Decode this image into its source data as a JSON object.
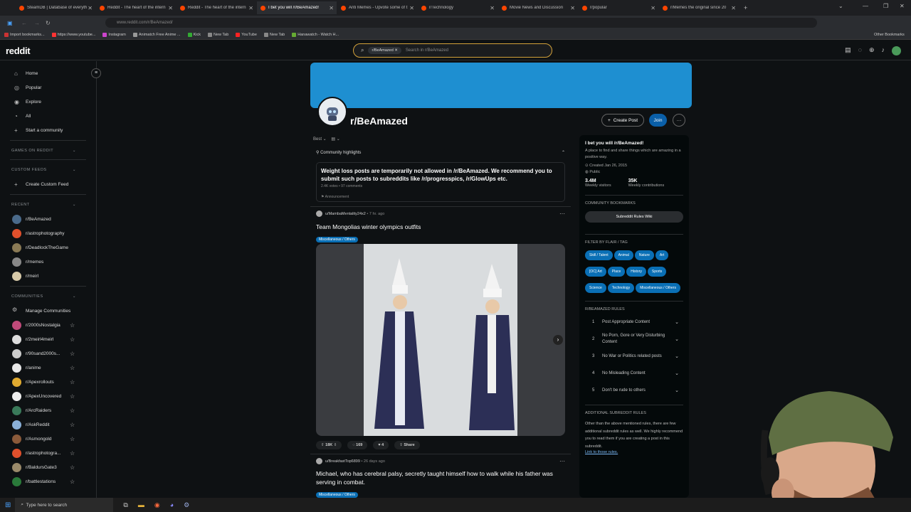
{
  "browser": {
    "tabs": [
      "SteamDB | Database of everyth",
      "Reddit - The heart of the intern",
      "Reddit - The heart of the intern",
      "I bet you will /r/BeAmazed!",
      "Anti Memes - Upvote some of t",
      "r/Technology",
      "Movie News and Discussion",
      "r/popular",
      "r/Memes the original since 20"
    ],
    "url": "www.reddit.com/r/BeAmazed/",
    "bookmarks": [
      "Import bookmarks...",
      "https://www.youtube...",
      "Instagram",
      "Animatch Free Anime ...",
      "Kick",
      "New Tab",
      "YouTube",
      "New Tab",
      "Hanawatch - Watch H..."
    ],
    "other_bookmarks": "Other Bookmarks"
  },
  "header": {
    "logo": "reddit",
    "search_chip": "r/BeAmazed",
    "search_placeholder": "Search in r/BeAmazed"
  },
  "sidebar": {
    "nav": [
      {
        "label": "Home",
        "icon": "home-icon",
        "glyph": "⌂"
      },
      {
        "label": "Popular",
        "icon": "popular-icon",
        "glyph": "◎"
      },
      {
        "label": "Explore",
        "icon": "explore-icon",
        "glyph": "◉"
      },
      {
        "label": "All",
        "icon": "all-icon",
        "glyph": "◔"
      },
      {
        "label": "Start a community",
        "icon": "plus-icon",
        "glyph": "+"
      }
    ],
    "games": "GAMES ON REDDIT",
    "custom_feeds": "CUSTOM FEEDS",
    "create_feed": "Create Custom Feed",
    "recent_title": "RECENT",
    "recent": [
      {
        "name": "r/BeAmazed",
        "color": "#4a6a8a"
      },
      {
        "name": "r/astrophotography",
        "color": "#e0502c"
      },
      {
        "name": "r/DeadlockTheGame",
        "color": "#8a7a55"
      },
      {
        "name": "r/memes",
        "color": "#888888"
      },
      {
        "name": "r/meirl",
        "color": "#d6c9a8"
      }
    ],
    "communities_title": "COMMUNITIES",
    "manage": "Manage Communities",
    "communities": [
      {
        "name": "r/2000sNostalgia",
        "color": "#c04a7a"
      },
      {
        "name": "r/2meirl4meirl",
        "color": "#dddddd"
      },
      {
        "name": "r/90sand2000s...",
        "color": "#cccccc"
      },
      {
        "name": "r/anime",
        "color": "#e8e8e8"
      },
      {
        "name": "r/Apexrollouts",
        "color": "#e0aa30"
      },
      {
        "name": "r/ApexUncovered",
        "color": "#eeeeee"
      },
      {
        "name": "r/ArcRaiders",
        "color": "#3a7a5a"
      },
      {
        "name": "r/AskReddit",
        "color": "#8ab0d8"
      },
      {
        "name": "r/Asmongold",
        "color": "#8a5a3a"
      },
      {
        "name": "r/astrophotogra...",
        "color": "#e0502c"
      },
      {
        "name": "r/BaldursGate3",
        "color": "#9a8a6a"
      },
      {
        "name": "r/battlestations",
        "color": "#2a7a3a"
      }
    ]
  },
  "community": {
    "name": "r/BeAmazed",
    "create_post": "Create Post",
    "join": "Join"
  },
  "feed": {
    "sort": "Best",
    "highlights_title": "Community highlights",
    "highlight_text": "Weight loss posts are temporarily not allowed in /r/BeAmazed. We recommend you to submit such posts to subreddits like /r/progresspics, /r/GlowUps etc.",
    "highlight_meta": "2.4K votes • 97 comments",
    "highlight_tag": "Announcement",
    "posts": [
      {
        "user": "u/MambaMentality24x2",
        "time": "• 7 hr. ago",
        "title": "Team Mongolias winter olympics outfits",
        "flair": "Miscellaneous / Others",
        "votes": "18K",
        "comments": "169",
        "awards": "4",
        "share": "Share"
      },
      {
        "user": "u/BreakfastTop6899",
        "time": "• 26 days ago",
        "title": "Michael, who has cerebral palsy, secretly taught himself how to walk while his father was serving in combat.",
        "flair": "Miscellaneous / Others"
      }
    ]
  },
  "about": {
    "title": "I bet you will /r/BeAmazed!",
    "desc": "A place to find and share things which are amazing in a positive way.",
    "created": "Created Jan 26, 2015",
    "visibility": "Public",
    "visitors": "3.4M",
    "visitors_label": "Weekly visitors",
    "contrib": "35K",
    "contrib_label": "Weekly contributions",
    "bookmarks_title": "COMMUNITY BOOKMARKS",
    "wiki": "Subreddit Rules Wiki",
    "flair_title": "FILTER BY FLAIR / TAG",
    "flairs": [
      "Skill / Talent",
      "Animal",
      "Nature",
      "Art",
      "[OC] Art",
      "Place",
      "History",
      "Sports",
      "Science",
      "Technology",
      "Miscellaneous / Others"
    ],
    "rules_title": "R/BEAMAZED RULES",
    "rules": [
      "Post Appropriate Content",
      "No Porn, Gore or Very Disturbing Content",
      "No War or Politics related posts",
      "No Misleading Content",
      "Don't be rude to others"
    ],
    "add_title": "ADDITIONAL SUBREDDIT RULES",
    "add_text": "Other than the above mentioned rules, there are few additional subreddit rules as well. We highly recommend you to read them if you are creating a post in this subreddit.",
    "add_link": "Link to those rules."
  },
  "taskbar": {
    "search": "Type here to search"
  }
}
